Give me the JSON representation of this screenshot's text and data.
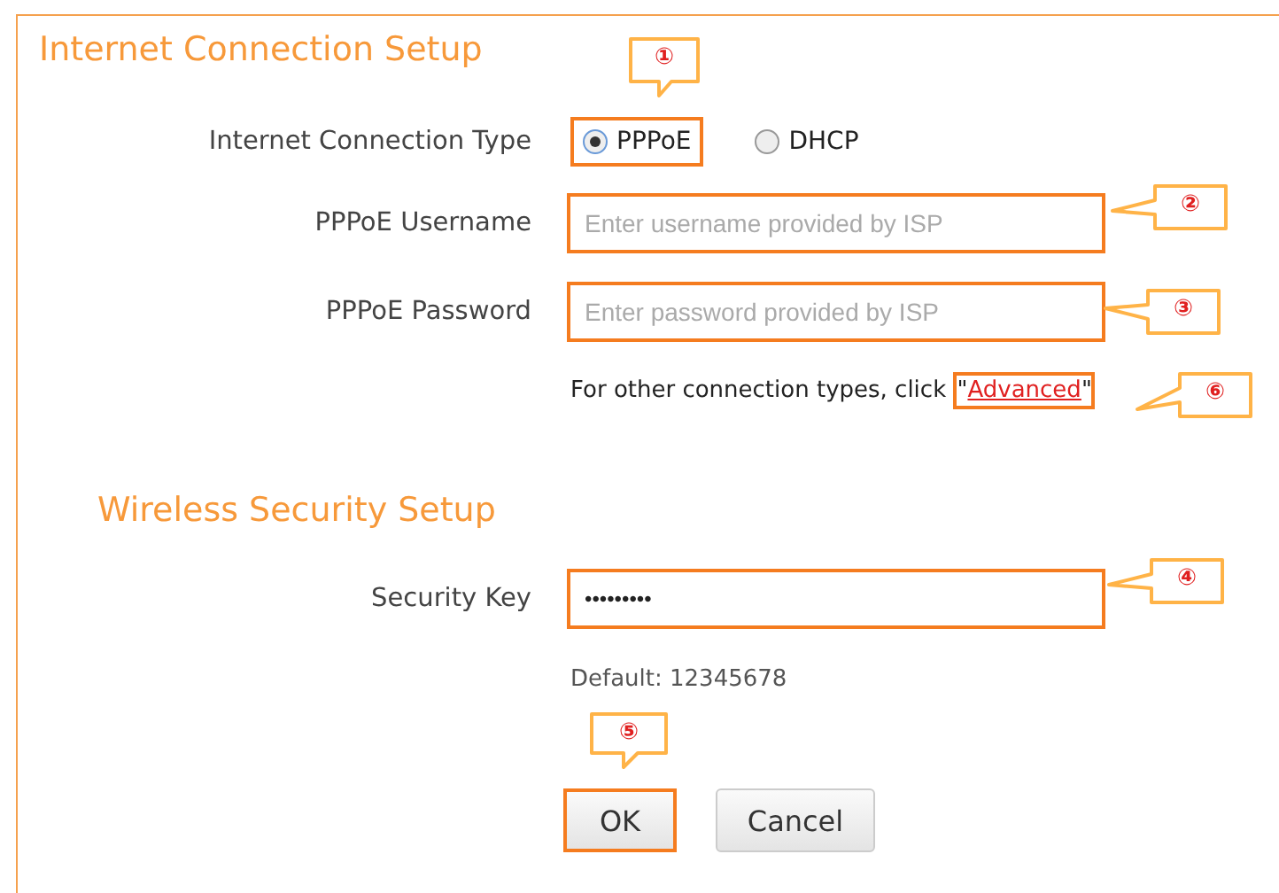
{
  "internet_setup": {
    "title": "Internet Connection Setup",
    "connection_type": {
      "label": "Internet Connection Type",
      "options": [
        {
          "label": "PPPoE",
          "selected": true,
          "highlighted": true,
          "callout": "①"
        },
        {
          "label": "DHCP",
          "selected": false,
          "highlighted": false
        }
      ]
    },
    "username": {
      "label": "PPPoE Username",
      "placeholder": "Enter username provided by ISP",
      "highlighted": true,
      "callout": "②"
    },
    "password": {
      "label": "PPPoE Password",
      "placeholder": "Enter password provided by ISP",
      "highlighted": true,
      "callout": "③"
    },
    "advanced_note": {
      "text": "For other connection types, click",
      "quote_open": "\"",
      "link": "Advanced",
      "quote_close": "\"",
      "highlighted": true,
      "callout": "⑥"
    }
  },
  "wireless_setup": {
    "title": "Wireless Security Setup",
    "security_key": {
      "label": "Security Key",
      "value": "•••••••••",
      "highlighted": true,
      "callout": "④"
    },
    "default_note": "Default: 12345678"
  },
  "buttons": [
    {
      "label": "OK",
      "highlighted": true,
      "callout": "⑤"
    },
    {
      "label": "Cancel",
      "highlighted": false
    }
  ]
}
